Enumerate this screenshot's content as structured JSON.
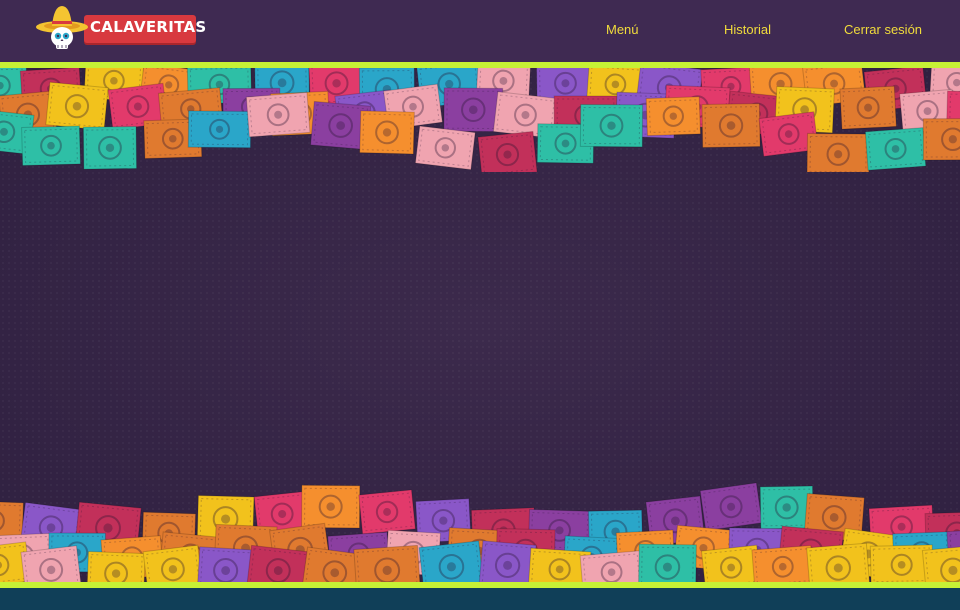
{
  "header": {
    "brand": "CALAVERITAS",
    "nav": [
      {
        "label": "Menú"
      },
      {
        "label": "Historial"
      },
      {
        "label": "Cerrar sesión"
      }
    ]
  },
  "colors": {
    "header_bg": "#3f2a52",
    "nav_text": "#f1dc3b",
    "accent_rail": "#c6f135",
    "page_bg": "#33223f",
    "footer_bg": "#103f58",
    "banner_red": "#d8393f",
    "papel_picado": [
      "#e07a2f",
      "#f2c21c",
      "#2aa6c9",
      "#e23a6b",
      "#8b3fa0",
      "#2ebfa6",
      "#f0a4b0",
      "#c2305a",
      "#8a57c8",
      "#f58f2e"
    ]
  },
  "icons": [
    "skull-sombrero-logo-icon",
    "papel-picado-decoration"
  ]
}
